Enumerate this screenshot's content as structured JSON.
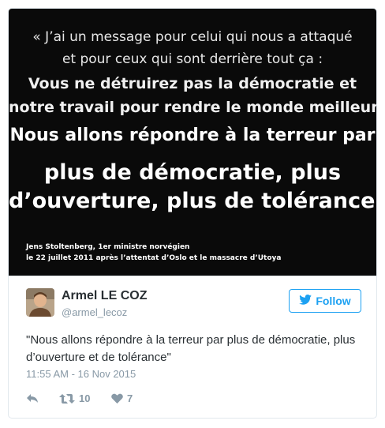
{
  "quote": {
    "line1": "« J’ai un message pour celui qui nous a attaqué",
    "line2": "et pour ceux qui sont derrière tout ça :",
    "line3": "Vous ne détruirez pas la démocratie et",
    "line4": "notre travail pour rendre le monde meilleur.",
    "line5": "Nous allons répondre à la terreur par",
    "line6": "plus de démocratie, plus",
    "line7": "d’ouverture, plus de tolérance. »",
    "credit1": "Jens Stoltenberg, 1er ministre norvégien",
    "credit2": "le 22 juillet 2011 après l’attentat d’Oslo et le massacre d’Utoya"
  },
  "author": {
    "name": "Armel LE COZ",
    "handle": "@armel_lecoz"
  },
  "follow_label": "Follow",
  "tweet": {
    "text": "\"Nous allons répondre à la terreur par plus de démocratie, plus d’ouverture et de tolérance\"",
    "timestamp": "11:55 AM - 16 Nov 2015"
  },
  "actions": {
    "retweets": "10",
    "likes": "7"
  },
  "colors": {
    "accent": "#1da1f2",
    "muted": "#8899a6",
    "text": "#292f33",
    "media_bg": "#0a0a0a"
  },
  "icons": [
    "reply-icon",
    "retweet-icon",
    "heart-icon",
    "twitter-bird-icon"
  ]
}
